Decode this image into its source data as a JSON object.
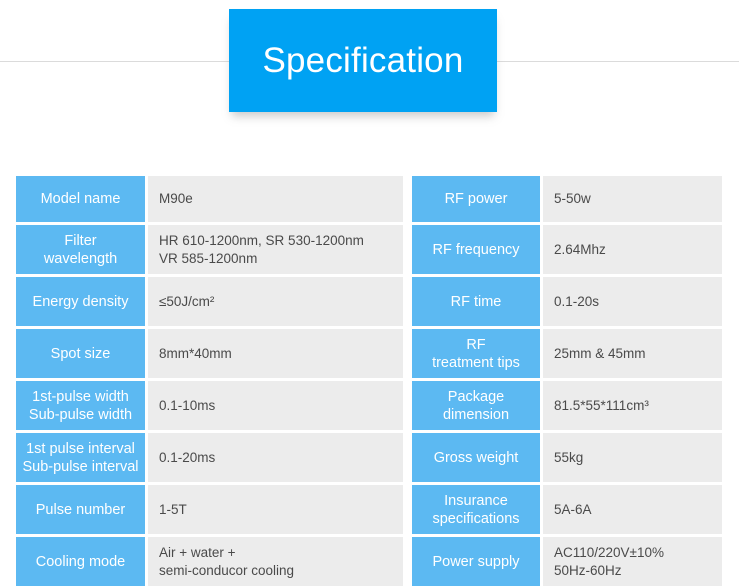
{
  "banner": {
    "title": "Specification",
    "background_color": "#00a2f3",
    "text_color": "#ffffff"
  },
  "theme": {
    "label_blue": "#5cb9f2",
    "value_gray": "#ececec",
    "value_text": "#4a4a4a",
    "rule_color": "#cfcfcf"
  },
  "spec_table": {
    "left_column": [
      {
        "label_line1": "Model name",
        "label_line2": "",
        "value_line1": "M90e",
        "value_line2": ""
      },
      {
        "label_line1": "Filter",
        "label_line2": "wavelength",
        "value_line1": "HR 610-1200nm, SR 530-1200nm",
        "value_line2": "VR 585-1200nm"
      },
      {
        "label_line1": "Energy density",
        "label_line2": "",
        "value_line1": "≤50J/cm²",
        "value_line2": ""
      },
      {
        "label_line1": "Spot size",
        "label_line2": "",
        "value_line1": "8mm*40mm",
        "value_line2": ""
      },
      {
        "label_line1": "1st-pulse width",
        "label_line2": "Sub-pulse width",
        "value_line1": "0.1-10ms",
        "value_line2": ""
      },
      {
        "label_line1": "1st pulse interval",
        "label_line2": "Sub-pulse interval",
        "value_line1": "0.1-20ms",
        "value_line2": ""
      },
      {
        "label_line1": "Pulse number",
        "label_line2": "",
        "value_line1": "1-5T",
        "value_line2": ""
      },
      {
        "label_line1": "Cooling mode",
        "label_line2": "",
        "value_line1": "Air + water +",
        "value_line2": "semi-conducor cooling"
      }
    ],
    "right_column": [
      {
        "label_line1": "RF power",
        "label_line2": "",
        "value_line1": "5-50w",
        "value_line2": ""
      },
      {
        "label_line1": "RF frequency",
        "label_line2": "",
        "value_line1": "2.64Mhz",
        "value_line2": ""
      },
      {
        "label_line1": "RF time",
        "label_line2": "",
        "value_line1": "0.1-20s",
        "value_line2": ""
      },
      {
        "label_line1": "RF",
        "label_line2": "treatment tips",
        "value_line1": "25mm & 45mm",
        "value_line2": ""
      },
      {
        "label_line1": "Package",
        "label_line2": "dimension",
        "value_line1": "81.5*55*111cm³",
        "value_line2": ""
      },
      {
        "label_line1": "Gross weight",
        "label_line2": "",
        "value_line1": "55kg",
        "value_line2": ""
      },
      {
        "label_line1": "Insurance",
        "label_line2": "specifications",
        "value_line1": "5A-6A",
        "value_line2": ""
      },
      {
        "label_line1": "Power supply",
        "label_line2": "",
        "value_line1": "AC110/220V±10%",
        "value_line2": "50Hz-60Hz"
      }
    ]
  }
}
